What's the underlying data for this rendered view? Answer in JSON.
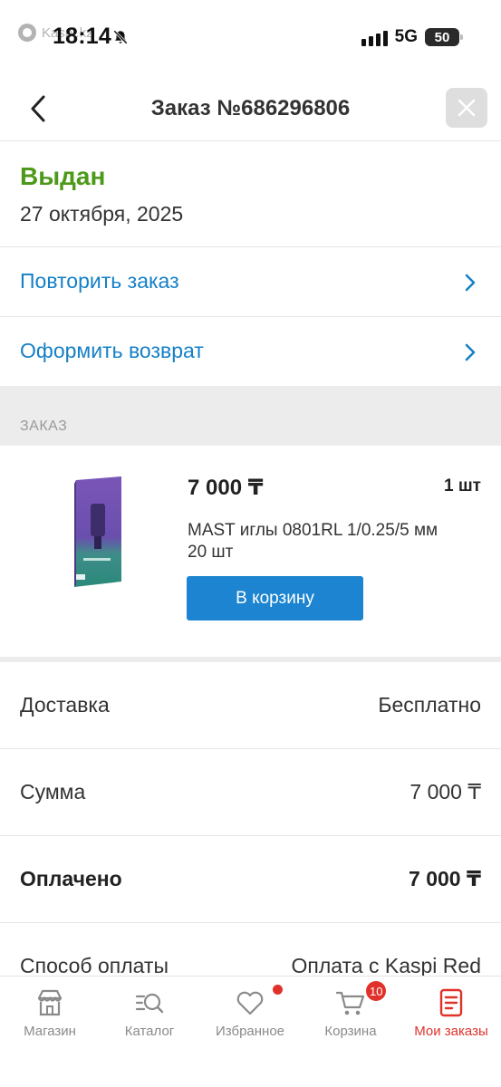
{
  "status_bar": {
    "app_hint": "Kaspi.kz",
    "time": "18:14",
    "network": "5G",
    "battery": "50"
  },
  "header": {
    "title": "Заказ №686296806"
  },
  "order_status": {
    "label": "Выдан",
    "date": "27 октября, 2025",
    "color": "#4d9a1a"
  },
  "actions": [
    {
      "label": "Повторить заказ"
    },
    {
      "label": "Оформить возврат"
    }
  ],
  "section": {
    "label": "ЗАКАЗ"
  },
  "product": {
    "price": "7 000 ₸",
    "quantity": "1 шт",
    "name": "MAST иглы 0801RL 1/0.25/5 мм 20 шт",
    "cart_button": "В корзину"
  },
  "summary": [
    {
      "key": "Доставка",
      "value": "Бесплатно"
    },
    {
      "key": "Сумма",
      "value": "7 000 ₸"
    },
    {
      "key": "Оплачено",
      "value": "7 000 ₸"
    },
    {
      "key": "Способ оплаты",
      "value": "Оплата с Kaspi Red"
    }
  ],
  "bottom_nav": [
    {
      "label": "Магазин",
      "icon": "store-icon"
    },
    {
      "label": "Каталог",
      "icon": "catalog-search-icon"
    },
    {
      "label": "Избранное",
      "icon": "heart-icon"
    },
    {
      "label": "Корзина",
      "icon": "cart-icon",
      "badge": "10"
    },
    {
      "label": "Мои заказы",
      "icon": "orders-icon",
      "active": true
    }
  ],
  "colors": {
    "accent_blue": "#1580c7",
    "button_blue": "#1c84d0",
    "active_red": "#e0322a"
  }
}
